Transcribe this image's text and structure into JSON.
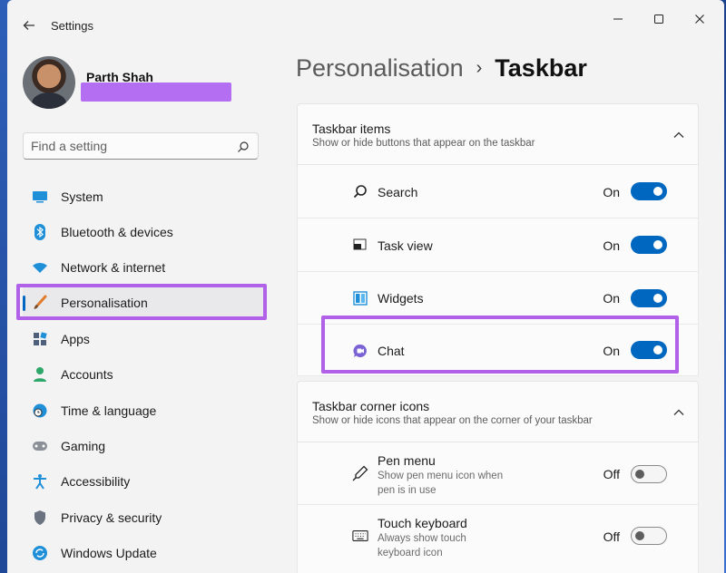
{
  "window": {
    "title": "Settings"
  },
  "profile": {
    "name": "Parth Shah"
  },
  "search": {
    "placeholder": "Find a setting"
  },
  "sidebar": {
    "items": [
      {
        "label": "System",
        "icon": "system-icon"
      },
      {
        "label": "Bluetooth & devices",
        "icon": "bluetooth-icon"
      },
      {
        "label": "Network & internet",
        "icon": "wifi-icon"
      },
      {
        "label": "Personalisation",
        "icon": "brush-icon",
        "selected": true
      },
      {
        "label": "Apps",
        "icon": "apps-icon"
      },
      {
        "label": "Accounts",
        "icon": "person-icon"
      },
      {
        "label": "Time & language",
        "icon": "globe-clock-icon"
      },
      {
        "label": "Gaming",
        "icon": "gamepad-icon"
      },
      {
        "label": "Accessibility",
        "icon": "accessibility-icon"
      },
      {
        "label": "Privacy & security",
        "icon": "shield-icon"
      },
      {
        "label": "Windows Update",
        "icon": "update-icon"
      }
    ]
  },
  "header": {
    "parent": "Personalisation",
    "separator": "›",
    "current": "Taskbar"
  },
  "taskbar_items": {
    "title": "Taskbar items",
    "subtitle": "Show or hide buttons that appear on the taskbar",
    "rows": [
      {
        "label": "Search",
        "state": "On",
        "on": true,
        "icon": "search-icon"
      },
      {
        "label": "Task view",
        "state": "On",
        "on": true,
        "icon": "task-view-icon"
      },
      {
        "label": "Widgets",
        "state": "On",
        "on": true,
        "icon": "widgets-icon"
      },
      {
        "label": "Chat",
        "state": "On",
        "on": true,
        "icon": "chat-icon"
      }
    ]
  },
  "corner_icons": {
    "title": "Taskbar corner icons",
    "subtitle": "Show or hide icons that appear on the corner of your taskbar",
    "rows": [
      {
        "label": "Pen menu",
        "sub": "Show pen menu icon when pen is in use",
        "state": "Off",
        "on": false,
        "icon": "pen-icon"
      },
      {
        "label": "Touch keyboard",
        "sub": "Always show touch keyboard icon",
        "state": "Off",
        "on": false,
        "icon": "keyboard-icon"
      }
    ]
  },
  "colors": {
    "accent": "#0067c0",
    "highlight": "#b160e8"
  }
}
